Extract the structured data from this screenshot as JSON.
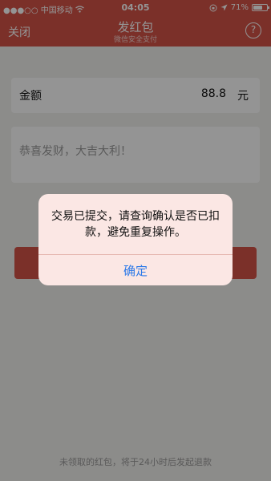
{
  "status_bar": {
    "carrier": "●●●○○ 中国移动",
    "time": "04:05",
    "battery": "71%",
    "battery_level": 0.71
  },
  "nav": {
    "close_label": "关闭",
    "title": "发红包",
    "subtitle": "微信安全支付",
    "help_label": "?"
  },
  "amount": {
    "label": "金额",
    "value": "88.8",
    "unit": "元"
  },
  "greeting": {
    "text": "恭喜发财，大吉大利！"
  },
  "footer_note": "未领取的红包，将于24小时后发起退款",
  "alert": {
    "message": "交易已提交，请查询确认是否已扣款，避免重复操作。",
    "confirm_label": "确定"
  },
  "colors": {
    "brand_red": "#d55448",
    "link_blue": "#2d7ae8"
  }
}
